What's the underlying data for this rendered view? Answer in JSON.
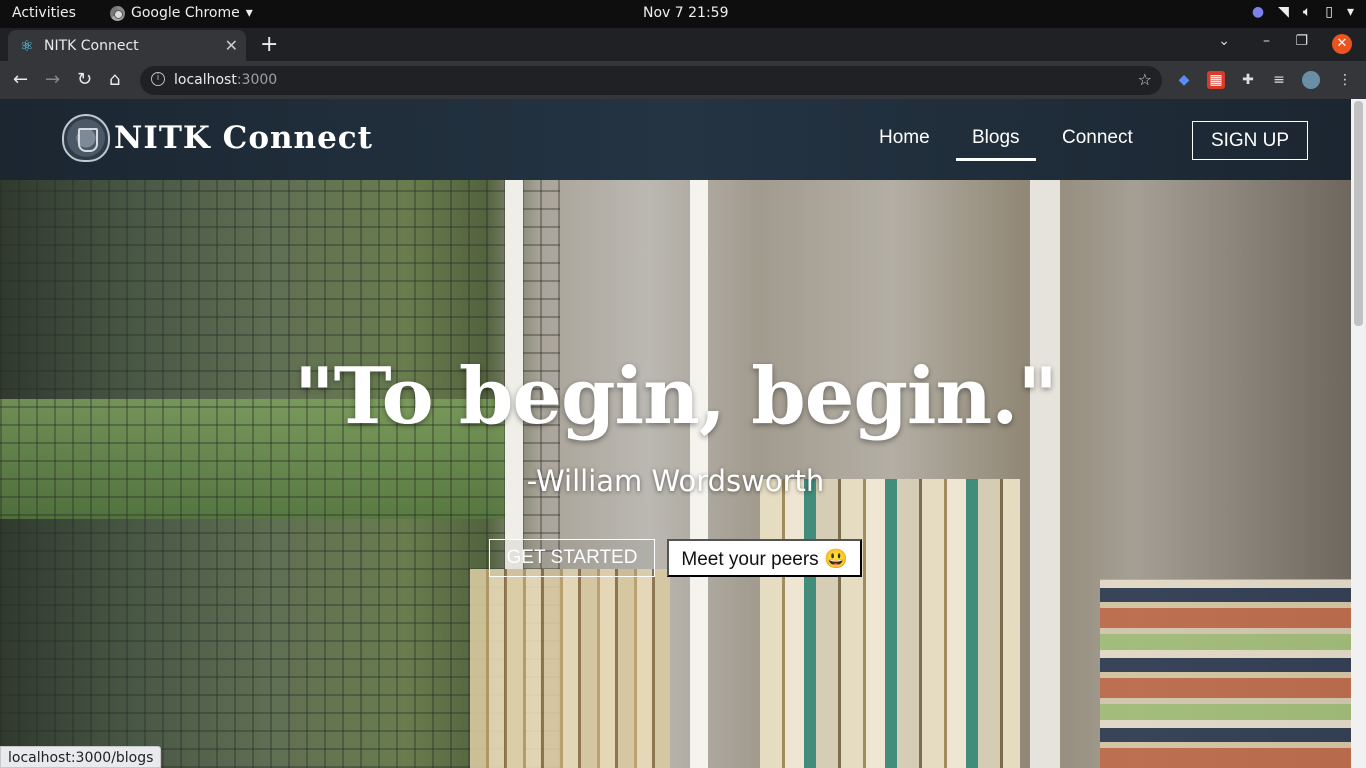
{
  "system": {
    "activities": "Activities",
    "app_name": "Google Chrome",
    "clock": "Nov 7  21:59"
  },
  "browser": {
    "tab_title": "NITK Connect",
    "url_host": "localhost",
    "url_port": ":3000",
    "status_url": "localhost:3000/blogs"
  },
  "navbar": {
    "brand": "NITK Connect",
    "links": [
      "Home",
      "Blogs",
      "Connect"
    ],
    "active_link": "Blogs",
    "signup": "SIGN UP"
  },
  "hero": {
    "quote": "\"To begin, begin.\"",
    "author": "-William Wordsworth",
    "primary_button": "GET STARTED",
    "secondary_button": "Meet your peers 😃"
  },
  "colors": {
    "navbar": "#1b2631",
    "tab_active": "#35363a",
    "close_button": "#e95420"
  }
}
